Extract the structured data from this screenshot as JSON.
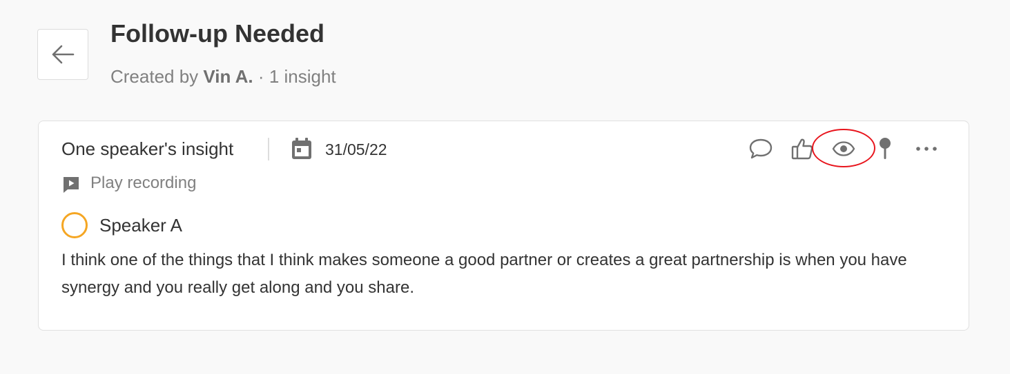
{
  "header": {
    "title": "Follow-up Needed",
    "created_by_prefix": "Created by",
    "author": "Vin A.",
    "separator": "·",
    "insight_count": "1 insight",
    "back_icon": "arrow-left-icon"
  },
  "insight": {
    "title": "One speaker's insight",
    "date": "31/05/22",
    "date_icon": "calendar-icon",
    "play_label": "Play recording",
    "play_icon": "video-play-icon",
    "speaker": {
      "name": "Speaker A",
      "color": "#f5a623"
    },
    "text": "I think one of the things that I think makes someone a good partner or creates a great partnership is when you have synergy and you really get along and you share.",
    "actions": [
      {
        "name": "comment",
        "icon": "comment-icon"
      },
      {
        "name": "like",
        "icon": "thumbs-up-icon"
      },
      {
        "name": "view",
        "icon": "eye-icon",
        "highlighted": true
      },
      {
        "name": "pin",
        "icon": "pin-icon"
      },
      {
        "name": "more",
        "icon": "more-horizontal-icon"
      }
    ]
  },
  "colors": {
    "background": "#f9f9f9",
    "card": "#ffffff",
    "text": "#333333",
    "muted": "#808080",
    "icon": "#707070",
    "highlight": "#e8141c"
  }
}
